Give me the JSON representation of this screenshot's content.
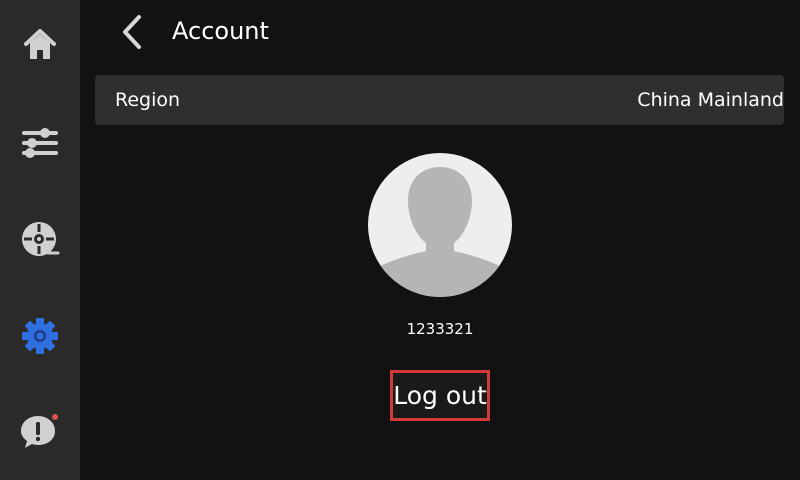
{
  "sidebar": {
    "items": [
      {
        "id": "home",
        "icon": "home-icon"
      },
      {
        "id": "controls",
        "icon": "sliders-icon"
      },
      {
        "id": "filament",
        "icon": "filament-spool-icon"
      },
      {
        "id": "settings",
        "icon": "gear-icon",
        "active": true
      },
      {
        "id": "help",
        "icon": "help-chat-icon",
        "has_notification": true
      }
    ]
  },
  "header": {
    "back_icon": "chevron-left-icon",
    "title": "Account"
  },
  "region": {
    "label": "Region",
    "value": "China Mainland"
  },
  "profile": {
    "avatar_icon": "user-silhouette-icon",
    "user_id": "1233321"
  },
  "logout": {
    "label": "Log out"
  },
  "colors": {
    "sidebar_bg": "#2a2a2a",
    "main_bg": "#121212",
    "icon_inactive": "#d0d0d0",
    "icon_active": "#2f6fe0",
    "notification_dot": "#e05050",
    "highlight_border": "#d33a3a"
  }
}
